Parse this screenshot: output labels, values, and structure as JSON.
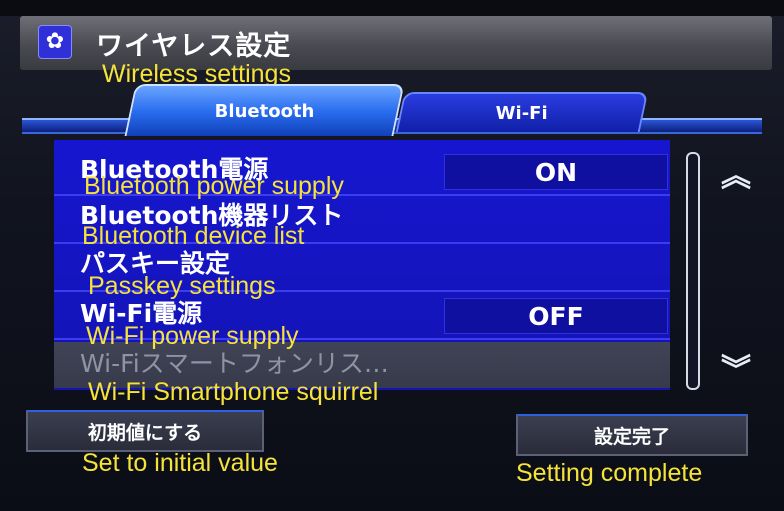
{
  "header": {
    "icon": "gear-icon",
    "title": "ワイヤレス設定",
    "annotation": "Wireless settings"
  },
  "tabs": [
    {
      "label": "Bluetooth",
      "selected": true
    },
    {
      "label": "Wi-Fi",
      "selected": false
    }
  ],
  "rows": [
    {
      "label": "Bluetooth電源",
      "value": "ON",
      "annotation": "Bluetooth power supply"
    },
    {
      "label": "Bluetooth機器リスト",
      "annotation": "Bluetooth device list"
    },
    {
      "label": "パスキー設定",
      "annotation": "Passkey settings"
    },
    {
      "label": "Wi-Fi電源",
      "value": "OFF",
      "annotation": "Wi-Fi power supply"
    },
    {
      "label": "Wi-Fiスマートフォンリス…",
      "disabled": true,
      "annotation": "Wi-Fi Smartphone squirrel"
    }
  ],
  "scroll": {
    "up_icon": "double-chevron-up-icon",
    "down_icon": "double-chevron-down-icon"
  },
  "footer": {
    "reset_label": "初期値にする",
    "reset_annotation": "Set to initial value",
    "done_label": "設定完了",
    "done_annotation": "Setting complete"
  },
  "colors": {
    "annotation": "#f6e33a",
    "list_bg": "#1616d0",
    "tab_active": "#2a6ef0"
  }
}
